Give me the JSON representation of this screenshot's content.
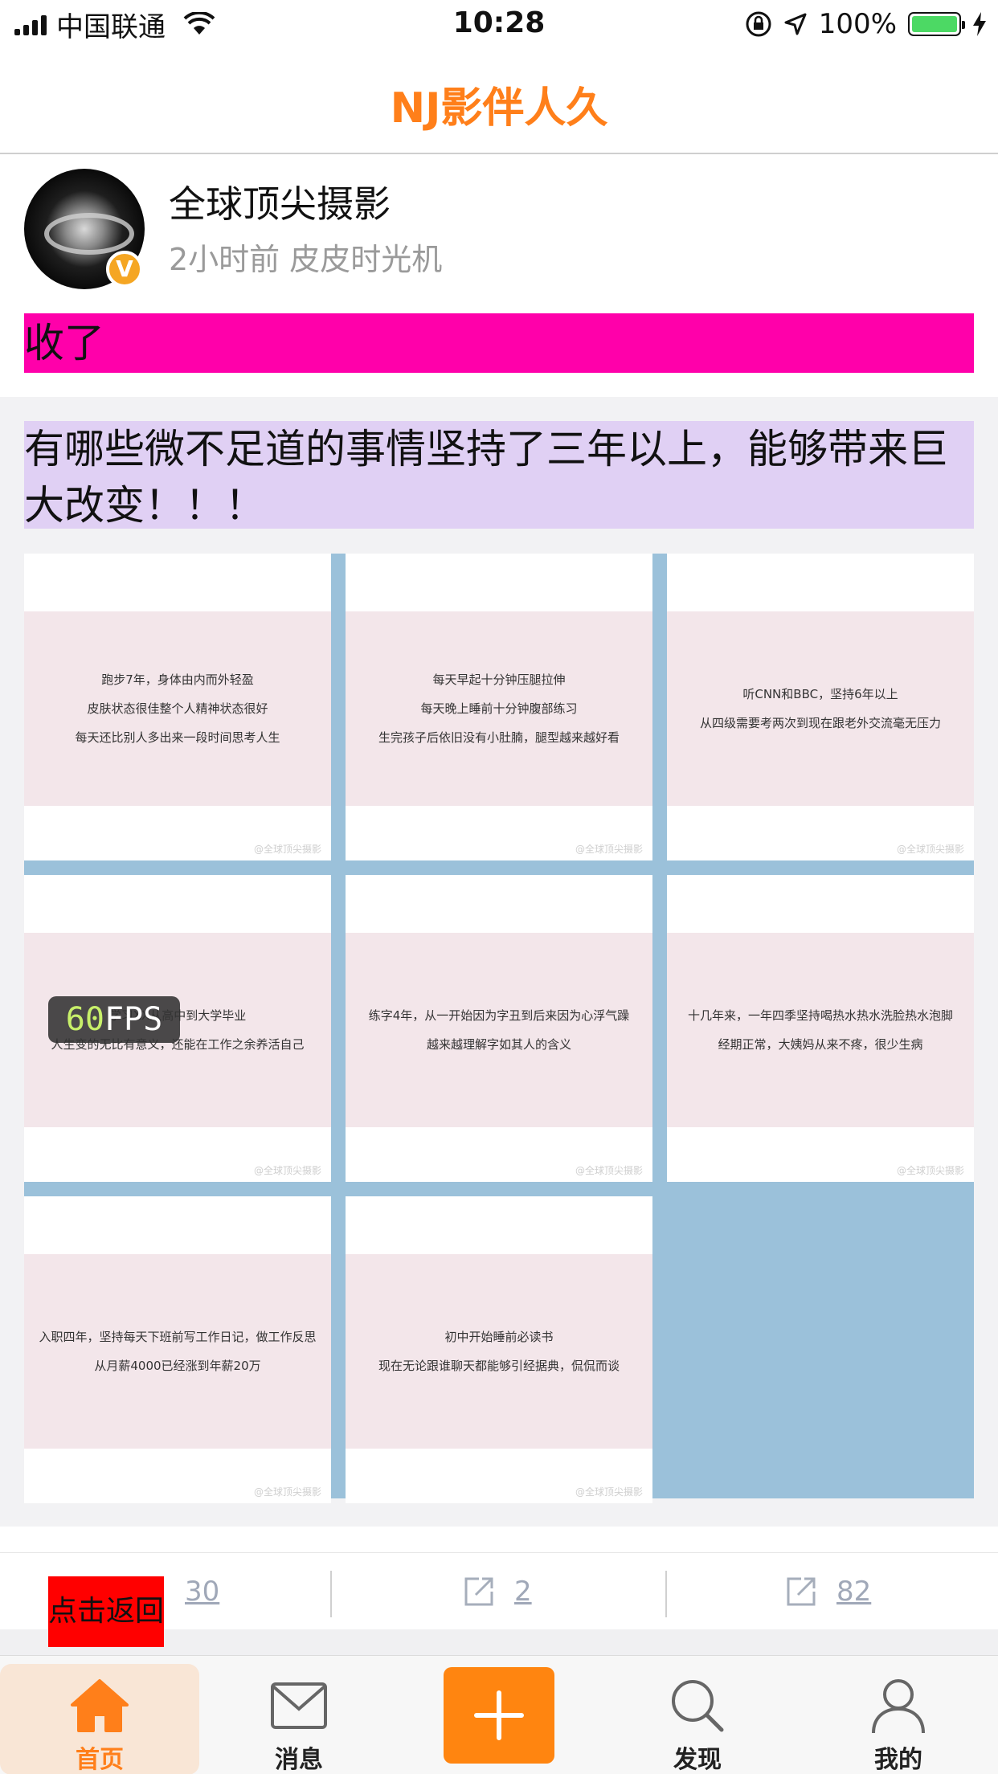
{
  "status_bar": {
    "carrier": "中国联通",
    "time": "10:28",
    "battery_pct": "100%",
    "battery_level": 1.0,
    "battery_color": "#4cd964"
  },
  "nav": {
    "title": "NJ影伴人久",
    "title_color": "#ff7f1a"
  },
  "post": {
    "author": "全球顶尖摄影",
    "badge": "V",
    "meta": "2小时前  皮皮时光机",
    "text": "收了",
    "text_bg": "#ff00aa"
  },
  "retweet": {
    "text": "有哪些微不足道的事情坚持了三年以上，能够带来巨大改变！！！",
    "text_bg": "#e0d0f4",
    "images": [
      {
        "lines": [
          "跑步7年，身体由内而外轻盈",
          "皮肤状态很佳整个人精神状态很好",
          "每天还比别人多出来一段时间思考人生"
        ]
      },
      {
        "lines": [
          "每天早起十分钟压腿拉伸",
          "每天晚上睡前十分钟腹部练习",
          "生完孩子后依旧没有小肚腩，腿型越来越好看"
        ]
      },
      {
        "lines": [
          "听CNN和BBC，坚持6年以上",
          "从四级需要考两次到现在跟老外交流毫无压力"
        ]
      },
      {
        "lines": [
          "学习XX从高中到大学毕业",
          "人生变的无比有意义，还能在工作之余养活自己"
        ]
      },
      {
        "lines": [
          "练字4年，从一开始因为字丑到后来因为心浮气躁",
          "越来越理解字如其人的含义"
        ]
      },
      {
        "lines": [
          "十几年来，一年四季坚持喝热水热水洗脸热水泡脚",
          "经期正常，大姨妈从来不疼，很少生病"
        ]
      },
      {
        "lines": [
          "入职四年，坚持每天下班前写工作日记，做工作反思",
          "从月薪4000已经涨到年薪20万"
        ]
      },
      {
        "lines": [
          "初中开始睡前必读书",
          "现在无论跟谁聊天都能够引经据典，侃侃而谈"
        ]
      }
    ],
    "watermark": "@全球顶尖摄影"
  },
  "fps": {
    "value": "60",
    "unit": "FPS"
  },
  "actions": {
    "comment_count": "30",
    "repost_count": "2",
    "share_count": "82",
    "back_label": "点击返回"
  },
  "tabbar": {
    "tabs": [
      {
        "label": "首页",
        "icon": "home-icon",
        "active": true
      },
      {
        "label": "消息",
        "icon": "mail-icon",
        "active": false
      },
      {
        "label": "",
        "icon": "plus-icon",
        "active": false
      },
      {
        "label": "发现",
        "icon": "search-icon",
        "active": false
      },
      {
        "label": "我的",
        "icon": "user-icon",
        "active": false
      }
    ],
    "active_color": "#ff7f1a",
    "plus_color": "#ff8510"
  }
}
